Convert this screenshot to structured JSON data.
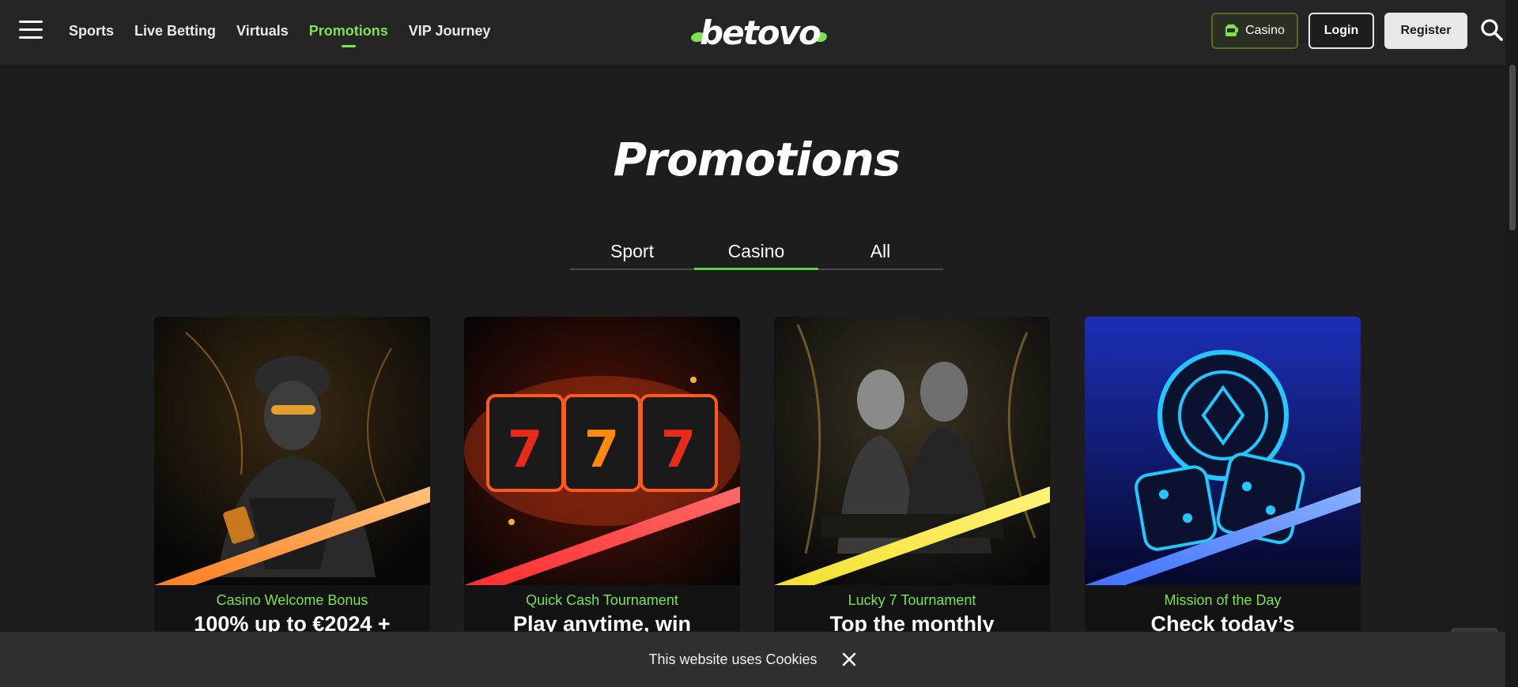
{
  "nav": {
    "menu_icon": "hamburger-menu-icon",
    "items": [
      {
        "label": "Sports",
        "active": false
      },
      {
        "label": "Live Betting",
        "active": false
      },
      {
        "label": "Virtuals",
        "active": false
      },
      {
        "label": "Promotions",
        "active": true
      },
      {
        "label": "VIP Journey",
        "active": false
      }
    ]
  },
  "brand": {
    "logo_text": "betovo",
    "accent": "#7ae34d"
  },
  "header_actions": {
    "casino_label": "Casino",
    "casino_icon": "slot-machine-icon",
    "login_label": "Login",
    "register_label": "Register",
    "search_icon": "search-icon"
  },
  "page": {
    "title": "Promotions"
  },
  "tabs": [
    {
      "label": "Sport",
      "active": false
    },
    {
      "label": "Casino",
      "active": true
    },
    {
      "label": "All",
      "active": false
    }
  ],
  "promos": [
    {
      "subtitle": "Casino Welcome Bonus",
      "title": "100% up to €2024 +",
      "accent": "#ff9a3c"
    },
    {
      "subtitle": "Quick Cash Tournament",
      "title": "Play anytime, win",
      "accent": "#ff3b3b"
    },
    {
      "subtitle": "Lucky 7 Tournament",
      "title": "Top the monthly",
      "accent": "#f5e23a"
    },
    {
      "subtitle": "Mission of the Day",
      "title": "Check today’s",
      "accent": "#4a7dff"
    }
  ],
  "cookie": {
    "text": "This website uses Cookies",
    "close_icon": "close-icon"
  }
}
